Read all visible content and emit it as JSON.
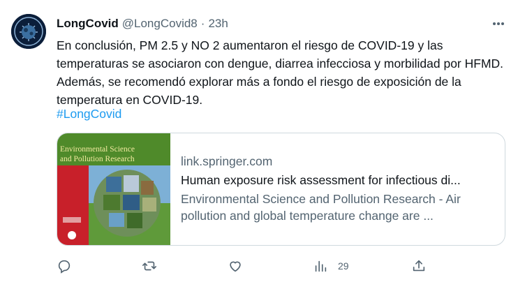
{
  "tweet": {
    "display_name": "LongCovid",
    "handle": "@LongCovid8",
    "separator": "·",
    "time": "23h",
    "text": "En conclusión, PM 2.5 y NO 2 aumentaron el riesgo de COVID-19 y las temperaturas se asociaron con dengue, diarrea infecciosa y morbilidad por HFMD. Además, se recomendó explorar más a fondo el riesgo de exposición de la temperatura en COVID-19.",
    "hashtag": "#LongCovid"
  },
  "card": {
    "domain": "link.springer.com",
    "title": "Human exposure risk assessment for infectious di...",
    "description": "Environmental Science and Pollution Research - Air pollution and global temperature change are ...",
    "image": {
      "journal_title_line1": "Environmental Science",
      "journal_title_line2": "and Pollution Research"
    }
  },
  "actions": {
    "reply_icon": "reply-icon",
    "retweet_icon": "retweet-icon",
    "like_icon": "heart-icon",
    "views_icon": "views-chart-icon",
    "views_count": "29",
    "share_icon": "share-icon",
    "more_icon": "more-horizontal-icon"
  },
  "colors": {
    "accent": "#1d9bf0",
    "secondary_text": "#536471",
    "border": "#cfd9de",
    "journal_red": "#c8202a",
    "journal_green": "#4f8a2a"
  }
}
